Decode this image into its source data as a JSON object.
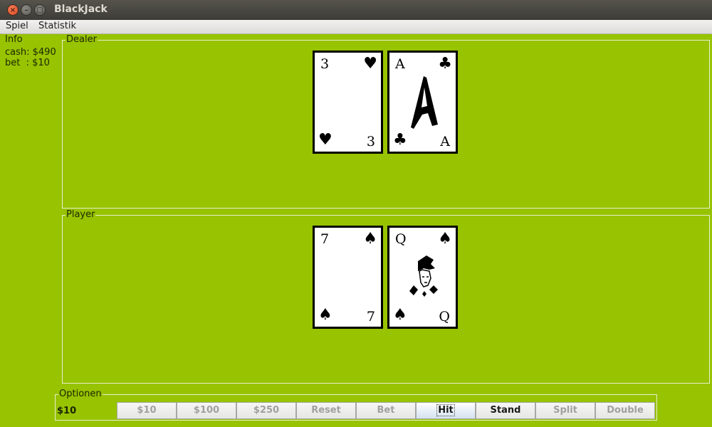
{
  "window": {
    "title": "BlackJack"
  },
  "menu": {
    "items": [
      "Spiel",
      "Statistik"
    ]
  },
  "info": {
    "title": "Info",
    "cash_line": "cash: $490",
    "bet_line": "bet  : $10"
  },
  "dealer": {
    "title": "Dealer",
    "cards": [
      {
        "rank": "3",
        "suit": "♥",
        "suit_name": "heart-icon"
      },
      {
        "rank": "A",
        "suit": "♣",
        "suit_name": "club-icon"
      }
    ]
  },
  "player": {
    "title": "Player",
    "cards": [
      {
        "rank": "7",
        "suit": "♠",
        "suit_name": "spade-icon"
      },
      {
        "rank": "Q",
        "suit": "♠",
        "suit_name": "spade-icon"
      }
    ]
  },
  "options": {
    "title": "Optionen",
    "selected_bet": "$10",
    "buttons": [
      {
        "label": "$10",
        "enabled": false
      },
      {
        "label": "$100",
        "enabled": false
      },
      {
        "label": "$250",
        "enabled": false
      },
      {
        "label": "Reset",
        "enabled": false
      },
      {
        "label": "Bet",
        "enabled": false
      },
      {
        "label": "Hit",
        "enabled": true,
        "focused": true
      },
      {
        "label": "Stand",
        "enabled": true
      },
      {
        "label": "Split",
        "enabled": false
      },
      {
        "label": "Double",
        "enabled": false
      }
    ]
  },
  "colors": {
    "table_green": "#97c300",
    "border": "#e8f0d0"
  }
}
